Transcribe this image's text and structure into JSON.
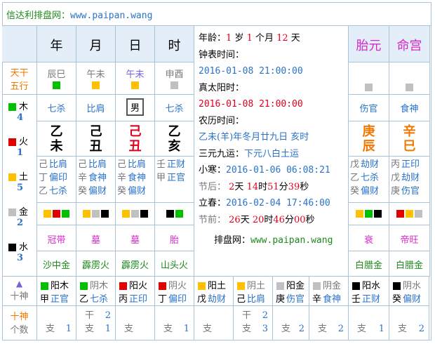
{
  "title": {
    "label": "信达利排盘网：",
    "url": "www.paipan.wang"
  },
  "pillars": [
    {
      "head": "年",
      "kong": "辰巳",
      "kong_sq": "#00c000",
      "shishen": "七杀",
      "gan": "乙",
      "zhi": "未",
      "gz_color": "#000",
      "cang": [
        [
          "己",
          "比肩"
        ],
        [
          "丁",
          "偏印"
        ],
        [
          "乙",
          "七杀"
        ]
      ],
      "sq": [
        "#ffc000",
        "#e00000",
        "#00c000"
      ],
      "state": "冠带",
      "nayin": "沙中金",
      "nayin_color": "#1d8a1d",
      "sw": [
        [
          "阳木",
          "#00c000"
        ],
        [
          "甲",
          "正官"
        ]
      ],
      "gan_count": "",
      "zhi_count": "1"
    },
    {
      "head": "月",
      "kong": "午未",
      "kong_sq": "#ffc000",
      "shishen": "比肩",
      "gan": "己",
      "zhi": "丑",
      "gz_color": "#000",
      "cang": [
        [
          "己",
          "比肩"
        ],
        [
          "辛",
          "食神"
        ],
        [
          "癸",
          "偏财"
        ]
      ],
      "sq": [
        "#ffc000",
        "#c0c0c0",
        "#000"
      ],
      "state": "墓",
      "nayin": "霹雳火",
      "nayin_color": "#1d8a1d",
      "sw": [
        [
          "阴木",
          "#00c000"
        ],
        [
          "乙",
          "七杀"
        ]
      ],
      "gan_count": "2",
      "zhi_count": "1"
    },
    {
      "head": "日",
      "kong": "午未",
      "kong_sq": "#ffc000",
      "shishen": "男",
      "gan": "己",
      "zhi": "丑",
      "gz_color": "#e0001a",
      "cang": [
        [
          "己",
          "比肩"
        ],
        [
          "辛",
          "食神"
        ],
        [
          "癸",
          "偏财"
        ]
      ],
      "sq": [
        "#ffc000",
        "#c0c0c0",
        "#000"
      ],
      "state": "墓",
      "nayin": "霹雳火",
      "nayin_color": "#1d8a1d",
      "sw": [
        [
          "阳火",
          "#e00000"
        ],
        [
          "丙",
          "正印"
        ]
      ],
      "gan_count": "",
      "zhi_count": ""
    },
    {
      "head": "时",
      "kong": "申酉",
      "kong_sq": "#c0c0c0",
      "shishen": "七杀",
      "gan": "乙",
      "zhi": "亥",
      "gz_color": "#000",
      "cang": [
        [
          "壬",
          "正财"
        ],
        [
          "甲",
          "正官"
        ],
        [
          "",
          ""
        ]
      ],
      "sq": [
        "#000",
        "#00c000",
        ""
      ],
      "state": "胎",
      "nayin": "山头火",
      "nayin_color": "#1d8a1d",
      "sw": [
        [
          "阴火",
          "#e00000"
        ],
        [
          "丁",
          "偏印"
        ]
      ],
      "gan_count": "",
      "zhi_count": "1"
    }
  ],
  "right_cols": [
    {
      "head": "胎元",
      "shishen": "伤官",
      "gan": "庚",
      "zhi": "辰",
      "cang": [
        [
          "戊",
          "劫财"
        ],
        [
          "乙",
          "七杀"
        ],
        [
          "癸",
          "偏财"
        ]
      ],
      "sq": [
        "#ffc000",
        "#00c000",
        "#000"
      ],
      "state": "衰",
      "nayin": "白腊金",
      "sw": [
        [
          "阳金",
          "#c0c0c0"
        ],
        [
          "庚",
          "伤官"
        ]
      ],
      "gan_count": "",
      "zhi_count": "2"
    },
    {
      "head": "命宫",
      "shishen": "食神",
      "gan": "辛",
      "zhi": "巳",
      "cang": [
        [
          "丙",
          "正印"
        ],
        [
          "戊",
          "劫财"
        ],
        [
          "庚",
          "伤官"
        ]
      ],
      "sq": [
        "#e00000",
        "#ffc000",
        "#c0c0c0"
      ],
      "state": "帝旺",
      "nayin": "白腊金",
      "sw": [
        [
          "阴金",
          "#c0c0c0"
        ],
        [
          "辛",
          "食神"
        ]
      ],
      "gan_count": "",
      "zhi_count": "2"
    },
    {
      "head": "",
      "shishen": "",
      "gan": "",
      "zhi": "",
      "cang": [],
      "sq": [],
      "state": "",
      "nayin": "",
      "sw": [
        [
          "阳水",
          "#000"
        ],
        [
          "壬",
          "正财"
        ]
      ],
      "gan_count": "",
      "zhi_count": "1"
    },
    {
      "head": "",
      "shishen": "",
      "gan": "",
      "zhi": "",
      "cang": [],
      "sq": [],
      "state": "",
      "nayin": "",
      "sw": [
        [
          "阴水",
          "#000"
        ],
        [
          "癸",
          "偏财"
        ]
      ],
      "gan_count": "",
      "zhi_count": "2"
    }
  ],
  "extra_sw": [
    {
      "sw": [
        [
          "阳土",
          "#ffc000"
        ],
        [
          "戊",
          "劫财"
        ]
      ],
      "gan_count": "",
      "zhi_count": ""
    },
    {
      "sw": [
        [
          "阴土",
          "#ffc000"
        ],
        [
          "己",
          "比肩"
        ]
      ],
      "gan_count": "2",
      "zhi_count": "3"
    }
  ],
  "left": {
    "tiangan": "天干",
    "wuxing": "五行",
    "elements": [
      [
        "木",
        "4",
        "#00c000"
      ],
      [
        "火",
        "1",
        "#e00000"
      ],
      [
        "土",
        "5",
        "#ffc000"
      ],
      [
        "金",
        "2",
        "#c0c0c0"
      ],
      [
        "水",
        "3",
        "#000"
      ]
    ],
    "shishen": "十神",
    "shishen_label": "十神",
    "count_label": "个数",
    "zhi": "支",
    "gan": "干",
    "triangle": "▲"
  },
  "info": {
    "age_label": "年龄：",
    "age": "1",
    "age_u1": "岁",
    "months": "1",
    "age_u2": "个月",
    "days": "12",
    "age_u3": "天",
    "clock_label": "钟表时间：",
    "clock": "2016-01-08 21:00:00",
    "solar_label": "真太阳时：",
    "solar": "2016-01-08 21:00:00",
    "lunar_label": "农历时间：",
    "lunar": "乙未(羊)年冬月廿九日 亥时",
    "yun_label": "三元九运：",
    "yun": "下元八白土运",
    "xh_label": "小寒：",
    "xh": "2016-01-06 06:08:21",
    "after_label": "节后：",
    "after_d": "2",
    "after_du": "天",
    "after_h": "14",
    "after_hu": "时",
    "after_m": "51",
    "after_mu": "分",
    "after_s": "39",
    "after_su": "秒",
    "lc_label": "立春：",
    "lc": "2016-02-04 17:46:00",
    "before_label": "节前：",
    "before_d": "26",
    "before_du": "天",
    "before_h": "20",
    "before_hu": "时",
    "before_m": "46",
    "before_mu": "分",
    "before_s": "00",
    "before_su": "秒",
    "site_label": "排盘网：",
    "site": "www.paipan.wang"
  }
}
